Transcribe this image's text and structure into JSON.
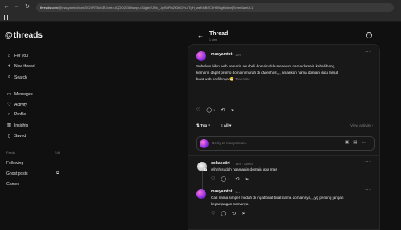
{
  "browser": {
    "url_host": "threads.com",
    "url_rest": "/@masyamtot/post/DI2bRT5kb7B?xmt=AQG0f2G8fnwgv-b34gknSJNk_Uy2WFtu2fGtO2vLqTgH_weKbiBSChHRWgfOdmrjZImmBaIeLf-1"
  },
  "sidebar": {
    "logo": "threads",
    "items": [
      {
        "label": "For you",
        "icon": "home-icon"
      },
      {
        "label": "New thread",
        "icon": "plus-icon"
      },
      {
        "label": "Search",
        "icon": "search-icon"
      },
      {
        "label": "Messages",
        "icon": "message-icon"
      },
      {
        "label": "Activity",
        "icon": "heart-icon"
      },
      {
        "label": "Profile",
        "icon": "profile-icon"
      },
      {
        "label": "Insights",
        "icon": "insights-icon"
      },
      {
        "label": "Saved",
        "icon": "bookmark-icon"
      }
    ],
    "feeds_label": "Feeds",
    "feeds_edit": "Edit",
    "feeds": [
      "Following",
      "Ghost posts",
      "Games"
    ]
  },
  "header": {
    "title": "Thread",
    "subtitle": "1 view"
  },
  "post": {
    "username": "masyamtot",
    "time": "16m",
    "text_lines": [
      "Sebelum bikin web kemarin aku beli domain dulu sebelum nama domain kebeli bang,",
      "kemarin dapet promo domain murah di idwebhost,,, amankan nama domain dulu lanjut",
      "buat web profilenya 😁"
    ],
    "translate": "Translate",
    "reply_count": "1"
  },
  "sort": {
    "top": "Top",
    "all": "All",
    "view_activity": "View activity"
  },
  "reply_box": {
    "placeholder": "Reply to masyamtot..."
  },
  "replies": [
    {
      "username": "cobaketiri",
      "time": "14m",
      "badge": "Author",
      "text": "wihhh sudah ngamanin domain apa mas",
      "reply_count": "1"
    },
    {
      "username": "masyamtot",
      "time": "1m",
      "text_lines": [
        "Cari nama simpel mudah di ingat buat buat nama domainnya,,, yg penting jangan",
        "kepanjangan namanya"
      ]
    }
  ],
  "colors": {
    "background": "#101010",
    "card": "#181818",
    "muted": "#7c7c7c"
  }
}
